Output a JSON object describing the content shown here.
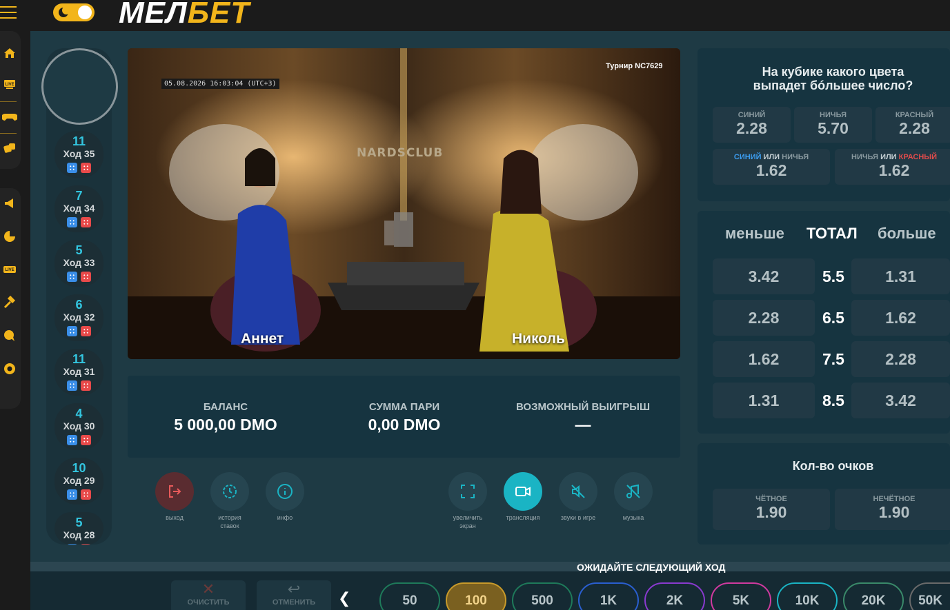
{
  "brand": {
    "logo_part1": "МЕЛ",
    "logo_part2": "БЕТ"
  },
  "sidebar": {
    "icons": [
      "home-icon",
      "live-icon",
      "gamepad-icon",
      "dice-icon",
      "megaphone-icon",
      "pie-chart-icon",
      "live-casino-icon",
      "hammer-icon",
      "chat-help-icon",
      "support-icon"
    ],
    "live_label": "LIVE"
  },
  "history": {
    "turns": [
      {
        "total": "11",
        "label": "Ход 35"
      },
      {
        "total": "7",
        "label": "Ход 34"
      },
      {
        "total": "5",
        "label": "Ход 33"
      },
      {
        "total": "6",
        "label": "Ход 32"
      },
      {
        "total": "11",
        "label": "Ход 31"
      },
      {
        "total": "4",
        "label": "Ход 30"
      },
      {
        "total": "10",
        "label": "Ход 29"
      },
      {
        "total": "5",
        "label": "Ход 28"
      }
    ]
  },
  "video": {
    "timestamp": "05.08.2026 16:03:04 (UTC+3)",
    "tournament": "Турнир NC7629",
    "club_logo": "NARDSCLUB",
    "player_left": "Аннет",
    "player_right": "Николь"
  },
  "balance": {
    "balance_label": "БАЛАНС",
    "balance_value": "5 000,00 DMO",
    "stake_label": "СУММА ПАРИ",
    "stake_value": "0,00 DMO",
    "win_label": "ВОЗМОЖНЫЙ ВЫИГРЫШ",
    "win_value": "—"
  },
  "controls": [
    {
      "name": "exit",
      "label": "выход"
    },
    {
      "name": "history",
      "label": "история ставок"
    },
    {
      "name": "info",
      "label": "инфо"
    },
    {
      "name": "fullscreen",
      "label": "увеличить экран"
    },
    {
      "name": "stream",
      "label": "трансляция"
    },
    {
      "name": "sounds",
      "label": "звуки в игре"
    },
    {
      "name": "music",
      "label": "музыка"
    }
  ],
  "color_market": {
    "question": "На кубике какого цвета выпадет бóльшее число?",
    "blue_label": "СИНИЙ",
    "blue_odd": "2.28",
    "draw_label": "НИЧЬЯ",
    "draw_odd": "5.70",
    "red_label": "КРАСНЫЙ",
    "red_odd": "2.28",
    "or_word": "ИЛИ",
    "blue_or_draw_odd": "1.62",
    "draw_or_red_odd": "1.62"
  },
  "total_market": {
    "less_label": "меньше",
    "title": "ТОТАЛ",
    "more_label": "больше",
    "rows": [
      {
        "less": "3.42",
        "line": "5.5",
        "more": "1.31"
      },
      {
        "less": "2.28",
        "line": "6.5",
        "more": "1.62"
      },
      {
        "less": "1.62",
        "line": "7.5",
        "more": "2.28"
      },
      {
        "less": "1.31",
        "line": "8.5",
        "more": "3.42"
      }
    ]
  },
  "points_market": {
    "title": "Кол-во очков",
    "even_label": "ЧЁТНОЕ",
    "even_odd": "1.90",
    "odd_label": "НЕЧЁТНОЕ",
    "odd_odd": "1.90"
  },
  "footer": {
    "status": "ОЖИДАЙТЕ СЛЕДУЮЩИЙ ХОД",
    "clear_label": "ОЧИСТИТЬ",
    "undo_label": "ОТМЕНИТЬ",
    "chips": [
      "50",
      "100",
      "500",
      "1K",
      "2K",
      "5K",
      "10K",
      "20K",
      "50K"
    ]
  },
  "colors": {
    "accent": "#f2b51b",
    "teal": "#1ab4c4",
    "bg": "#1e3a44"
  }
}
